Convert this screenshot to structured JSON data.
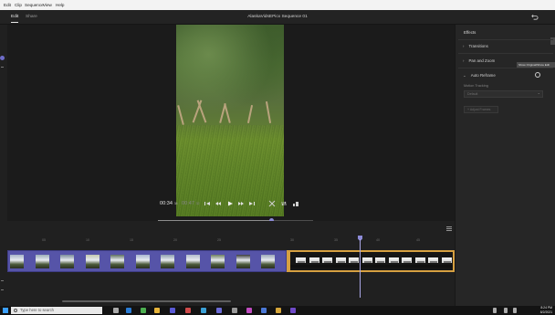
{
  "menu": {
    "items": [
      "Edit",
      "Clip",
      "Sequence",
      "View",
      "Help"
    ]
  },
  "header": {
    "tabs": [
      {
        "label": "Edit",
        "active": true
      },
      {
        "label": "Share",
        "active": false
      }
    ],
    "sequence_title": "AlaskaVidsEPicx Sequence 01"
  },
  "player": {
    "current_time": "00:34",
    "current_frames": "38",
    "total_time": "00:47",
    "total_frames": "32",
    "playhead_progress": 0.73
  },
  "effects": {
    "title": "Effects",
    "sections": [
      {
        "label": "Transitions",
        "expanded": false
      },
      {
        "label": "Pan and Zoom",
        "expanded": false
      },
      {
        "label": "Auto Reframe",
        "expanded": true
      }
    ],
    "tooltip": "Show Original/Show Edit",
    "motion_tracking_label": "Motion Tracking",
    "motion_tracking_value": "Default",
    "adjust_button": "Adjust Frames"
  },
  "timeline": {
    "ruler_labels": [
      "05",
      "10",
      "15",
      "20",
      "25",
      "30",
      "35",
      "40",
      "45"
    ]
  },
  "taskbar": {
    "search_placeholder": "Type here to search",
    "time": "8:24 PM",
    "date": "8/2/2021"
  },
  "colors": {
    "accent": "#8d8bd8",
    "clip_purple": "#5654a8",
    "clip_selected_border": "#d6a041"
  }
}
